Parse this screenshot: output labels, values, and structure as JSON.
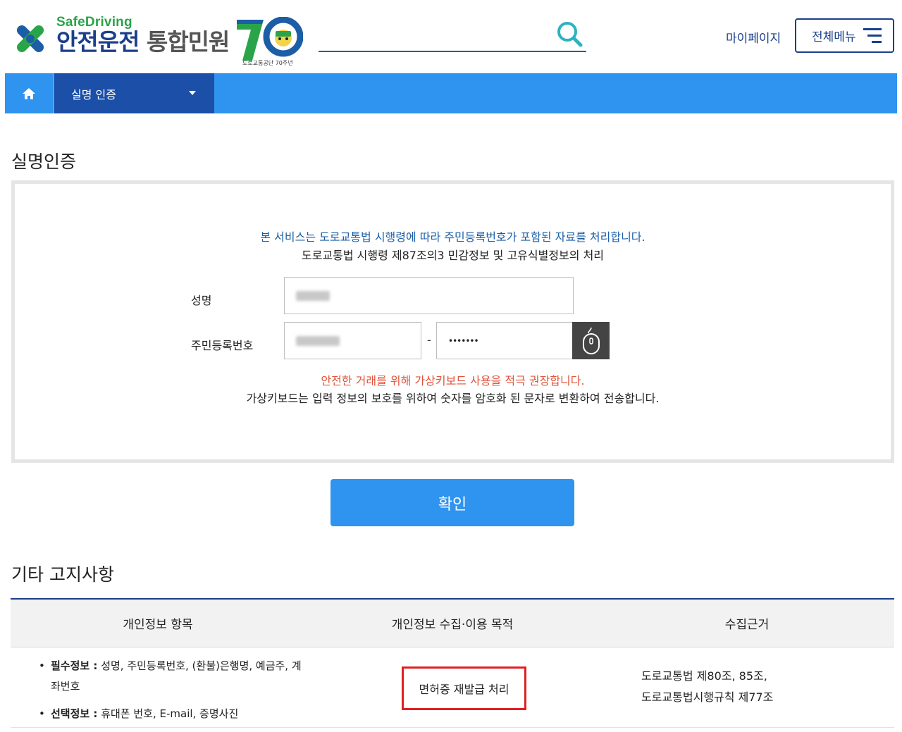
{
  "header": {
    "logo_sub": "SafeDriving",
    "logo_main_blue": "안전운전",
    "logo_main_gray": "통합민원",
    "anniversary_caption": "도로교통공단 70주년",
    "search_placeholder": "",
    "mypage_label": "마이페이지",
    "allmenu_label": "전체메뉴"
  },
  "nav": {
    "home_icon": "home-icon",
    "current_label": "실명 인증"
  },
  "auth": {
    "title": "실명인증",
    "notice_blue": "본 서비스는 도로교통법 시행령에 따라 주민등록번호가 포함된 자료를 처리합니다.",
    "notice_dark": "도로교통법 시행령 제87조의3 민감정보 및 고유식별정보의 처리",
    "name_label": "성명",
    "rrn_label": "주민등록번호",
    "rrn_separator": "-",
    "rrn_back_value": "•••••••",
    "warn_red": "안전한 거래를 위해 가상키보드 사용을 적극 권장합니다.",
    "warn_dark": "가상키보드는 입력 정보의 보호를 위하여 숫자를 암호화 된 문자로 변환하여 전송합니다.",
    "confirm_label": "확인"
  },
  "notice": {
    "title": "기타 고지사항",
    "columns": [
      "개인정보 항목",
      "개인정보 수집·이용 목적",
      "수집근거"
    ],
    "required_label": "필수정보 :",
    "required_text": " 성명, 주민등록번호, (환불)은행명, 예금주, 계좌번호",
    "optional_label": "선택정보 :",
    "optional_text": " 휴대폰 번호, E-mail, 증명사진",
    "purpose": "면허증 재발급 처리",
    "basis_line1": "도로교통법 제80조, 85조,",
    "basis_line2": "도로교통법시행규칙 제77조"
  },
  "colors": {
    "brand_blue": "#1b3f8b",
    "nav_blue": "#2f93f0",
    "nav_dark": "#1b4fa8",
    "logo_green": "#2aa449",
    "warning_red": "#e0533a",
    "highlight_red": "#e02020"
  }
}
